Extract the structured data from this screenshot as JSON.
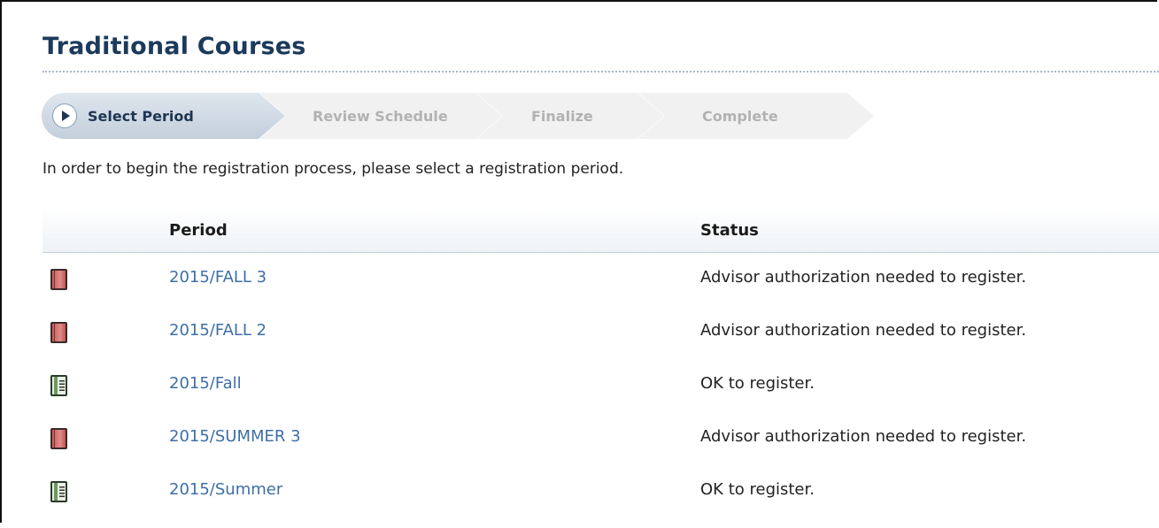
{
  "page": {
    "title": "Traditional Courses"
  },
  "stepper": {
    "steps": [
      {
        "label": "Select Period",
        "state": "active"
      },
      {
        "label": "Review Schedule",
        "state": "inactive"
      },
      {
        "label": "Finalize",
        "state": "inactive"
      },
      {
        "label": "Complete",
        "state": "inactive"
      }
    ]
  },
  "intro": "In order to begin the registration process, please select a registration period.",
  "table": {
    "headers": {
      "icon": "",
      "period": "Period",
      "status": "Status"
    },
    "rows": [
      {
        "icon": "book-closed-red-icon",
        "period": "2015/FALL 3",
        "status": "Advisor authorization needed to register."
      },
      {
        "icon": "book-closed-red-icon",
        "period": "2015/FALL 2",
        "status": "Advisor authorization needed to register."
      },
      {
        "icon": "book-open-green-icon",
        "period": "2015/Fall",
        "status": "OK to register."
      },
      {
        "icon": "book-closed-red-icon",
        "period": "2015/SUMMER 3",
        "status": "Advisor authorization needed to register."
      },
      {
        "icon": "book-open-green-icon",
        "period": "2015/Summer",
        "status": "OK to register."
      }
    ]
  },
  "colors": {
    "title": "#1b3a5c",
    "link": "#3d6fa8",
    "active_step": "#c3cfdb",
    "red_book": "#d47070",
    "green_book": "#6e9a5e"
  }
}
